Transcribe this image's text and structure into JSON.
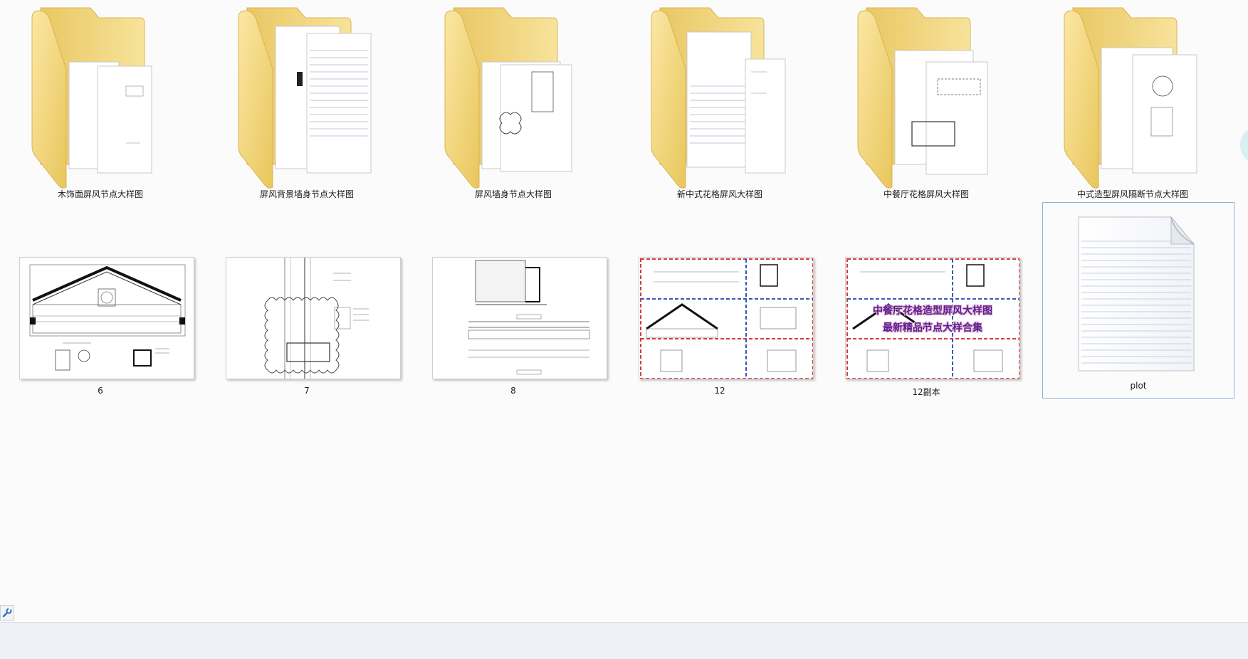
{
  "folders": [
    {
      "label": "木饰面屏风节点大样图"
    },
    {
      "label": "屏风背景墙身节点大样图"
    },
    {
      "label": "屏风墙身节点大样图"
    },
    {
      "label": "新中式花格屏风大样图"
    },
    {
      "label": "中餐厅花格屏风大样图"
    },
    {
      "label": "中式造型屏风隔断节点大样图"
    }
  ],
  "files": [
    {
      "label": "6"
    },
    {
      "label": "7"
    },
    {
      "label": "8"
    },
    {
      "label": "12"
    },
    {
      "label": "12副本",
      "overlay_line1": "中餐厅花格造型屏风大样图",
      "overlay_line2": "最新精品节点大样合集"
    },
    {
      "label": "plot"
    }
  ],
  "colors": {
    "folder": "#f3d77a",
    "selection_border": "#8fb2d8",
    "stamp_red": "#d33a3a",
    "stamp_blue": "#3a56b5"
  },
  "icons": {
    "status": "wrench-icon"
  }
}
